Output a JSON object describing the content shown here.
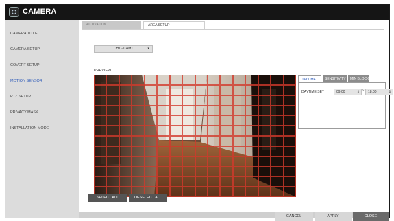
{
  "app": {
    "title": "CAMERA",
    "icon": "camera-icon"
  },
  "sidebar": {
    "items": [
      {
        "label": "CAMERA TITLE",
        "active": false
      },
      {
        "label": "CAMERA SETUP",
        "active": false
      },
      {
        "label": "COVERT SETUP",
        "active": false
      },
      {
        "label": "MOTION SENSOR",
        "active": true
      },
      {
        "label": "PTZ SETUP",
        "active": false
      },
      {
        "label": "PRIVACY MASK",
        "active": false
      },
      {
        "label": "INSTALLATION MODE",
        "active": false
      }
    ]
  },
  "tabs": [
    {
      "label": "ACTIVATION",
      "active": false
    },
    {
      "label": "AREA SETUP",
      "active": true
    }
  ],
  "camera_select": {
    "value": "CH1 - CAM1"
  },
  "preview": {
    "label": "PREVIEW",
    "grid": {
      "columns": 16,
      "rows": 12,
      "line_color": "#d23a2c"
    }
  },
  "right_tabs": [
    {
      "label": "DAYTIME",
      "active": true
    },
    {
      "label": "SENSITIVITY",
      "active": false
    },
    {
      "label": "MIN BLOCK",
      "active": false
    }
  ],
  "daytime": {
    "label": "DAYTIME SET",
    "start": "09:00",
    "separator": "~",
    "end": "18:00"
  },
  "buttons": {
    "select_all": "SELECT ALL",
    "deselect_all": "DESELECT ALL"
  },
  "footer": {
    "cancel": "CANCEL",
    "apply": "APPLY",
    "close": "CLOSE"
  },
  "colors": {
    "accent": "#2b58b8",
    "title_bar": "#151515",
    "sidebar": "#dcdcdc",
    "grid": "#d23a2c"
  }
}
